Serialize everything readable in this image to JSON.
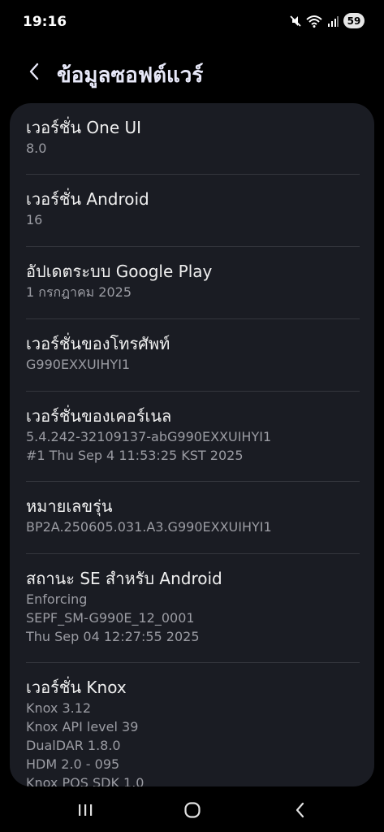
{
  "status_bar": {
    "time": "19:16",
    "battery": "59",
    "icons": [
      "mute-icon",
      "wifi-icon",
      "signal-icon",
      "battery-icon"
    ]
  },
  "header": {
    "title": "ข้อมูลซอฟต์แวร์",
    "back_icon": "chevron-left-icon"
  },
  "items": [
    {
      "title": "เวอร์ชั่น One UI",
      "lines": [
        "8.0"
      ]
    },
    {
      "title": "เวอร์ชั่น Android",
      "lines": [
        "16"
      ]
    },
    {
      "title": "อัปเดตระบบ Google Play",
      "lines": [
        "1 กรกฎาคม 2025"
      ]
    },
    {
      "title": "เวอร์ชั่นของโทรศัพท์",
      "lines": [
        "G990EXXUIHYI1"
      ]
    },
    {
      "title": "เวอร์ชั่นของเคอร์เนล",
      "lines": [
        "5.4.242-32109137-abG990EXXUIHYI1",
        "#1 Thu Sep 4 11:53:25 KST 2025"
      ]
    },
    {
      "title": "หมายเลขรุ่น",
      "lines": [
        "BP2A.250605.031.A3.G990EXXUIHYI1"
      ]
    },
    {
      "title": "สถานะ SE สำหรับ Android",
      "lines": [
        "Enforcing",
        "SEPF_SM-G990E_12_0001",
        "Thu Sep 04 12:27:55 2025"
      ]
    },
    {
      "title": "เวอร์ชั่น Knox",
      "lines": [
        "Knox 3.12",
        "Knox API level 39",
        "DualDAR 1.8.0",
        "HDM 2.0 - 095",
        "Knox POS SDK 1.0"
      ]
    }
  ],
  "nav_bar": {
    "recent_icon": "recent-apps-icon",
    "home_icon": "home-icon",
    "back_icon": "back-icon"
  },
  "colors": {
    "background": "#000000",
    "card": "#1a1c23",
    "title": "#e7e8f8",
    "secondary_text": "#9b9ca3"
  }
}
